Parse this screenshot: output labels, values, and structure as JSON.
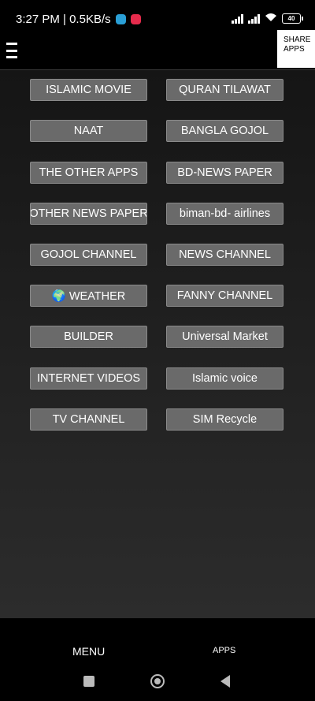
{
  "status_bar": {
    "time_speed": "3:27 PM | 0.5KB/s",
    "battery": "40"
  },
  "header": {
    "share_label_line1": "SHARE",
    "share_label_line2": "APPS"
  },
  "buttons_left": [
    "ISLAMIC MOVIE",
    "NAAT",
    "THE OTHER APPS",
    "OTHER NEWS PAPER",
    "GOJOL CHANNEL",
    "🌍 WEATHER",
    "BUILDER",
    "INTERNET VIDEOS",
    "TV CHANNEL"
  ],
  "buttons_right": [
    "QURAN TILAWAT",
    "BANGLA GOJOL",
    "BD-NEWS PAPER",
    "biman-bd- airlines",
    "NEWS CHANNEL",
    "FANNY CHANNEL",
    "Universal Market",
    "Islamic voice",
    "SIM Recycle"
  ],
  "bottom_nav": {
    "menu": "MENU",
    "apps": "APPS"
  },
  "colors": {
    "button_bg": "#6a6a6a",
    "telegram_badge": "#2a9fd6",
    "youtube_badge": "#e62b4c"
  }
}
